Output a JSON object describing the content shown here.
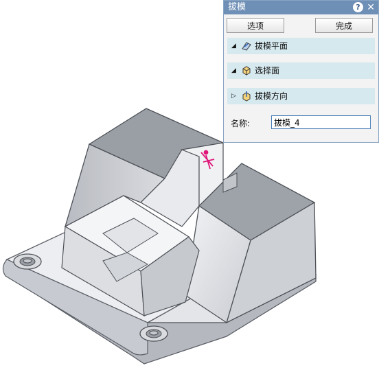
{
  "dialog": {
    "title": "拔模",
    "help_symbol": "?",
    "close_symbol": "✕",
    "options_label": "选项",
    "finish_label": "完成",
    "sections": [
      {
        "label": "拔模平面",
        "expanded": true,
        "icon": "draft-plane-icon"
      },
      {
        "label": "选择面",
        "expanded": true,
        "icon": "select-face-icon"
      },
      {
        "label": "拔模方向",
        "expanded": false,
        "icon": "draft-direction-icon"
      }
    ],
    "name_label": "名称:",
    "name_value": "拔模_4"
  },
  "colors": {
    "title_bar": "#6e8fb6",
    "section_bg": "#d6e9ef",
    "model_face_light": "#e6e8ec",
    "model_face_dark": "#8b8f96",
    "draft_marker": "#e0157a"
  }
}
